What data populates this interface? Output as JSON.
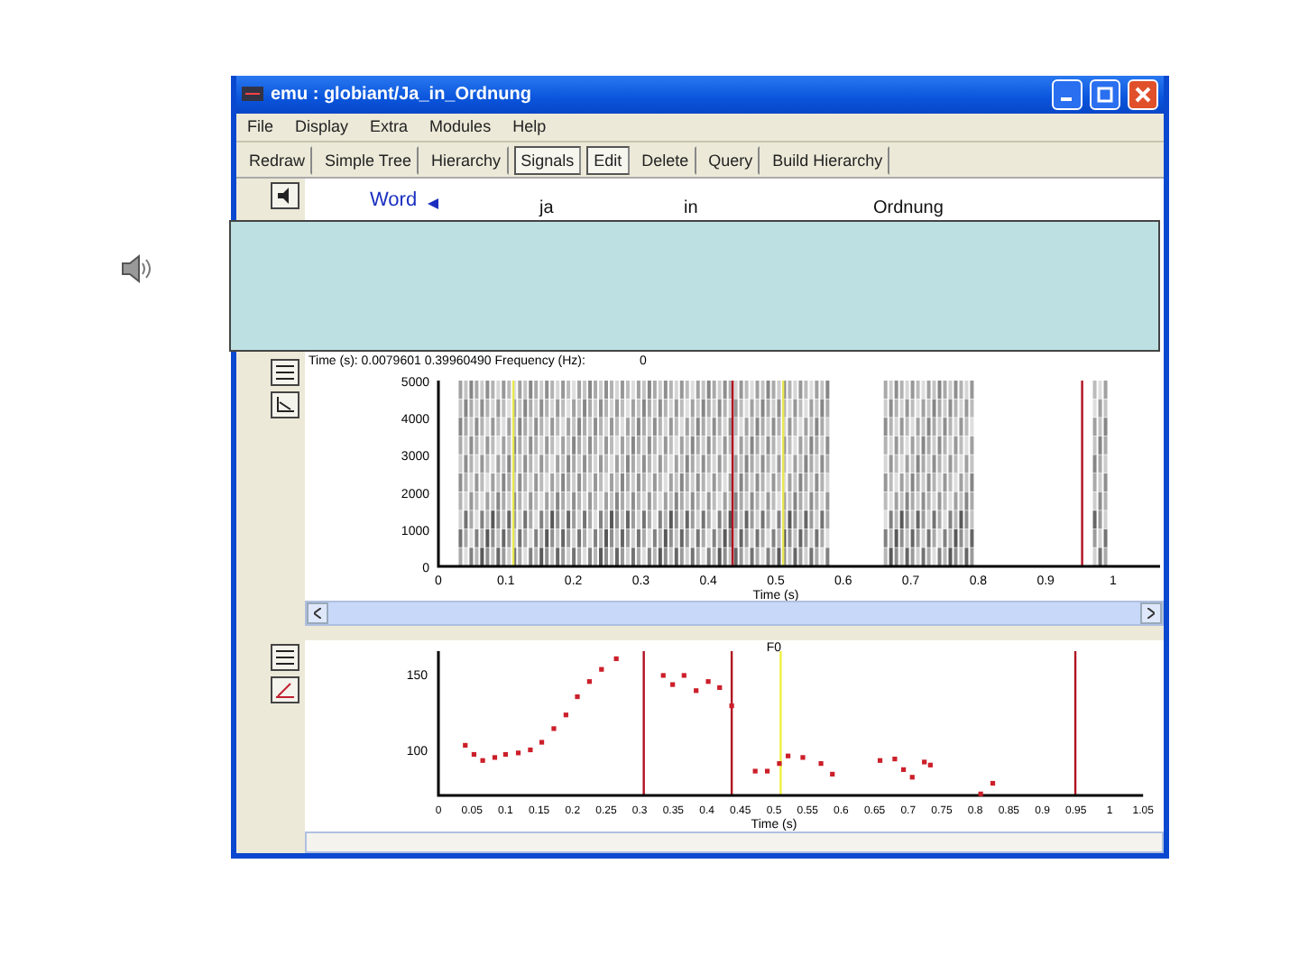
{
  "window": {
    "title": "emu : globiant/Ja_in_Ordnung"
  },
  "menu": [
    "File",
    "Display",
    "Extra",
    "Modules",
    "Help"
  ],
  "toolbar": [
    {
      "label": "Redraw",
      "selected": false
    },
    {
      "label": "Simple Tree",
      "selected": false
    },
    {
      "label": "Hierarchy",
      "selected": false
    },
    {
      "label": "Signals",
      "selected": true
    },
    {
      "label": "Edit",
      "selected": true
    },
    {
      "label": "Delete",
      "selected": false
    },
    {
      "label": "Query",
      "selected": false
    },
    {
      "label": "Build Hierarchy",
      "selected": false
    }
  ],
  "tier": {
    "name": "Word",
    "labels": [
      "ja",
      "in",
      "Ordnung"
    ]
  },
  "info": {
    "text": "Time (s): 0.0079601 0.39960490 Frequency (Hz):",
    "value": "0"
  },
  "spectrogram": {
    "yticks": [
      "5000",
      "4000",
      "3000",
      "2000",
      "1000",
      "0"
    ],
    "xticks": [
      "0",
      "0.1",
      "0.2",
      "0.3",
      "0.4",
      "0.5",
      "0.6",
      "0.7",
      "0.8",
      "0.9",
      "1"
    ],
    "xlabel": "Time (s)"
  },
  "f0": {
    "chart_data": {
      "type": "scatter",
      "title": "F0",
      "xlabel": "Time (s)",
      "xlim": [
        0,
        1.05
      ],
      "ylim": [
        70,
        165
      ],
      "xticks": [
        0,
        0.05,
        0.1,
        0.15,
        0.2,
        0.25,
        0.3,
        0.35,
        0.4,
        0.45,
        0.5,
        0.55,
        0.6,
        0.65,
        0.7,
        0.75,
        0.8,
        0.85,
        0.9,
        0.95,
        1,
        1.05
      ],
      "yticks": [
        100,
        150
      ],
      "x": [
        0.04,
        0.053,
        0.066,
        0.084,
        0.1,
        0.119,
        0.137,
        0.154,
        0.172,
        0.19,
        0.207,
        0.225,
        0.243,
        0.265,
        0.335,
        0.349,
        0.366,
        0.384,
        0.402,
        0.419,
        0.437,
        0.472,
        0.49,
        0.508,
        0.521,
        0.543,
        0.57,
        0.587,
        0.658,
        0.68,
        0.693,
        0.706,
        0.724,
        0.733,
        0.808,
        0.826
      ],
      "series": [
        {
          "color": "#cc1f2a",
          "values": [
            103,
            97,
            93,
            95,
            97,
            98,
            100,
            105,
            114,
            123,
            135,
            145,
            153,
            160,
            149,
            143,
            149,
            139,
            145,
            141,
            129,
            86,
            86,
            91,
            96,
            95,
            91,
            84,
            93,
            94,
            87,
            82,
            92,
            90,
            71,
            78
          ]
        }
      ],
      "ref_lines": [
        {
          "axis": "x",
          "value": 0.306,
          "color": "#b01020"
        },
        {
          "axis": "x",
          "value": 0.437,
          "color": "#b01020"
        },
        {
          "axis": "x",
          "value": 0.51,
          "color": "#f0f040"
        },
        {
          "axis": "x",
          "value": 0.949,
          "color": "#b01020"
        }
      ]
    }
  }
}
